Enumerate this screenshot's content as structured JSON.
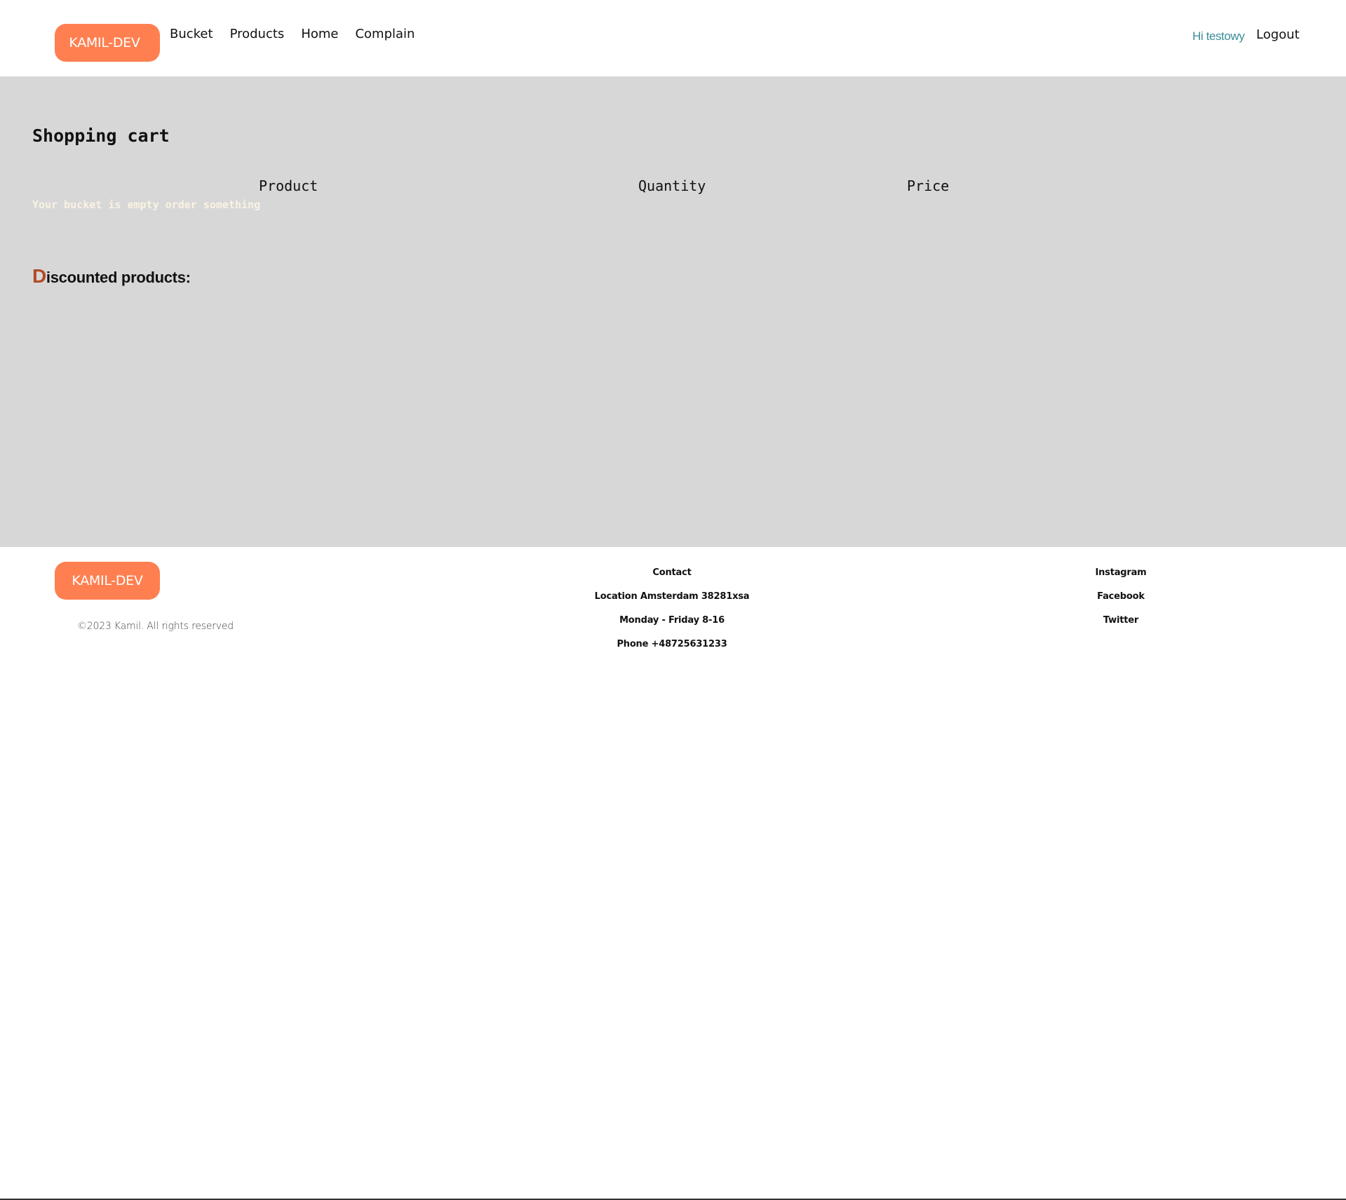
{
  "header": {
    "logo": "KAMIL-DEV",
    "nav": {
      "bucket": "Bucket",
      "products": "Products",
      "home": "Home",
      "complain": "Complain"
    },
    "greeting": "Hi testowy",
    "logout": "Logout"
  },
  "cart": {
    "title": "Shopping cart",
    "columns": {
      "product": "Product",
      "quantity": "Quantity",
      "price": "Price"
    },
    "empty_message": "Your bucket is empty order something"
  },
  "discounted": {
    "title_first_letter": "D",
    "title_rest": "iscounted products:"
  },
  "footer": {
    "logo": "KAMIL-DEV",
    "copyright": "©2023 Kamil. All rights reserved",
    "contact": {
      "heading": "Contact",
      "location": "Location Amsterdam 38281xsa",
      "hours": "Monday - Friday 8-16",
      "phone": "Phone +48725631233"
    },
    "social": {
      "instagram": "Instagram",
      "facebook": "Facebook",
      "twitter": "Twitter"
    }
  },
  "colors": {
    "brand": "#ff7f50",
    "main_bg": "#d8d7d8",
    "greeting": "#3a8e96",
    "discount_accent": "#b04b27",
    "empty_text": "#f9f3e2"
  }
}
